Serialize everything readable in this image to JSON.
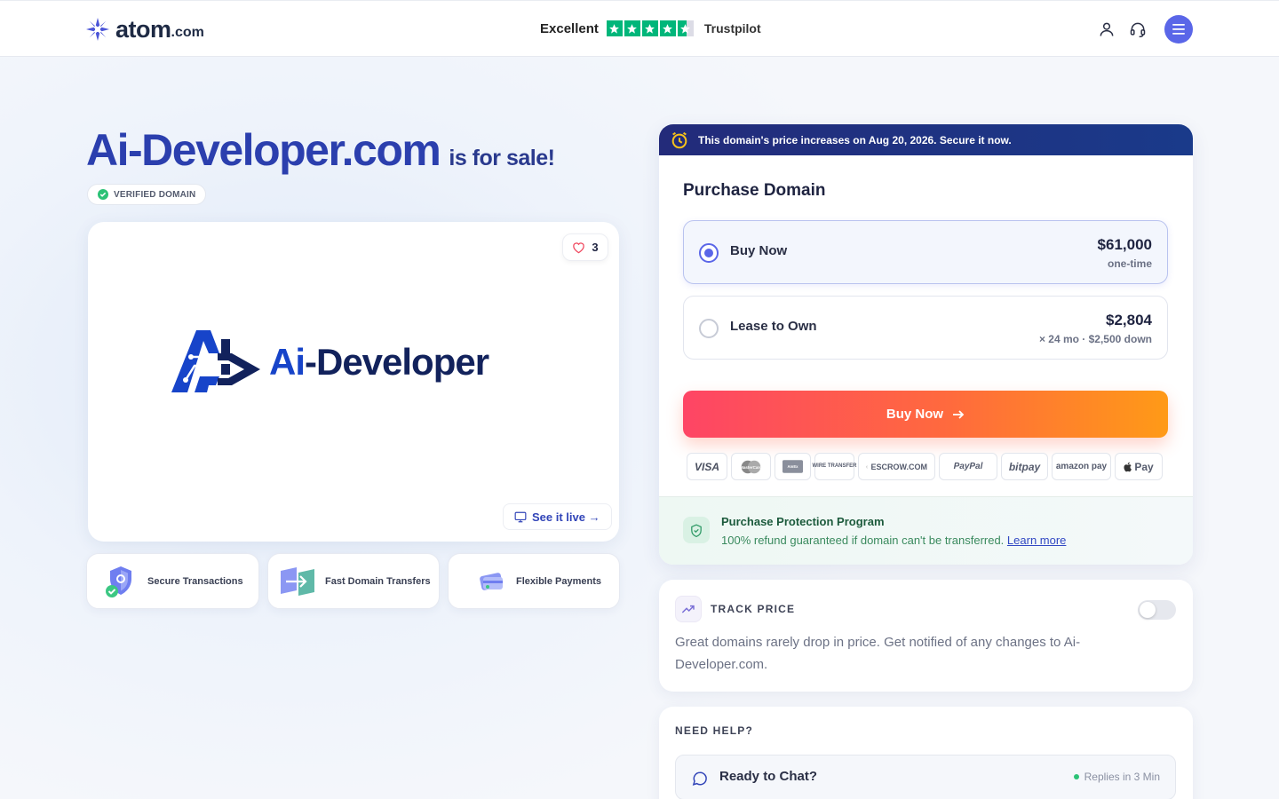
{
  "header": {
    "logo_text": "atom",
    "logo_suffix": ".com",
    "trustpilot_rating_text": "Excellent",
    "trustpilot_stars": 4.5,
    "trustpilot_name": "Trustpilot"
  },
  "listing": {
    "domain": "Ai-Developer.com",
    "for_sale_text": "is for sale!",
    "verified_label": "VERIFIED DOMAIN",
    "likes": "3",
    "brand_logo_text_ai": "Ai",
    "brand_logo_text_rest": "-Developer",
    "see_live_label": "See it live →"
  },
  "features": [
    {
      "label": "Secure Transactions",
      "icon": "shield-icon"
    },
    {
      "label": "Fast Domain Transfers",
      "icon": "transfer-icon"
    },
    {
      "label": "Flexible Payments",
      "icon": "card-icon"
    }
  ],
  "purchase": {
    "promo_text": "This domain's price increases on Aug 20, 2026. Secure it now.",
    "title": "Purchase Domain",
    "options": [
      {
        "label": "Buy Now",
        "price": "$61,000",
        "sub": "one-time",
        "selected": true
      },
      {
        "label": "Lease to Own",
        "price": "$2,804",
        "sub": "× 24 mo · $2,500 down",
        "selected": false
      }
    ],
    "buy_button_label": "Buy Now",
    "payment_methods": [
      "VISA",
      "MasterCard",
      "AmEx",
      "WIRE TRANSFER",
      "ESCROW.COM",
      "PayPal",
      "bitpay",
      "amazon pay",
      "Pay"
    ],
    "protection_title": "Purchase Protection Program",
    "protection_desc": "100% refund guaranteed if domain can't be transferred.",
    "protection_link": "Learn more"
  },
  "track": {
    "title": "TRACK PRICE",
    "enabled": false,
    "desc": "Great domains rarely drop in price. Get notified of any changes to Ai-Developer.com."
  },
  "help": {
    "title": "NEED HELP?",
    "chat_label": "Ready to Chat?",
    "chat_status": "Replies in 3 Min"
  },
  "colors": {
    "accent": "#5a66e8",
    "domain_blue": "#2b3fae",
    "trustpilot_green": "#00b67a",
    "buy_gradient_start": "#fe4565",
    "buy_gradient_end": "#ff9a17"
  }
}
